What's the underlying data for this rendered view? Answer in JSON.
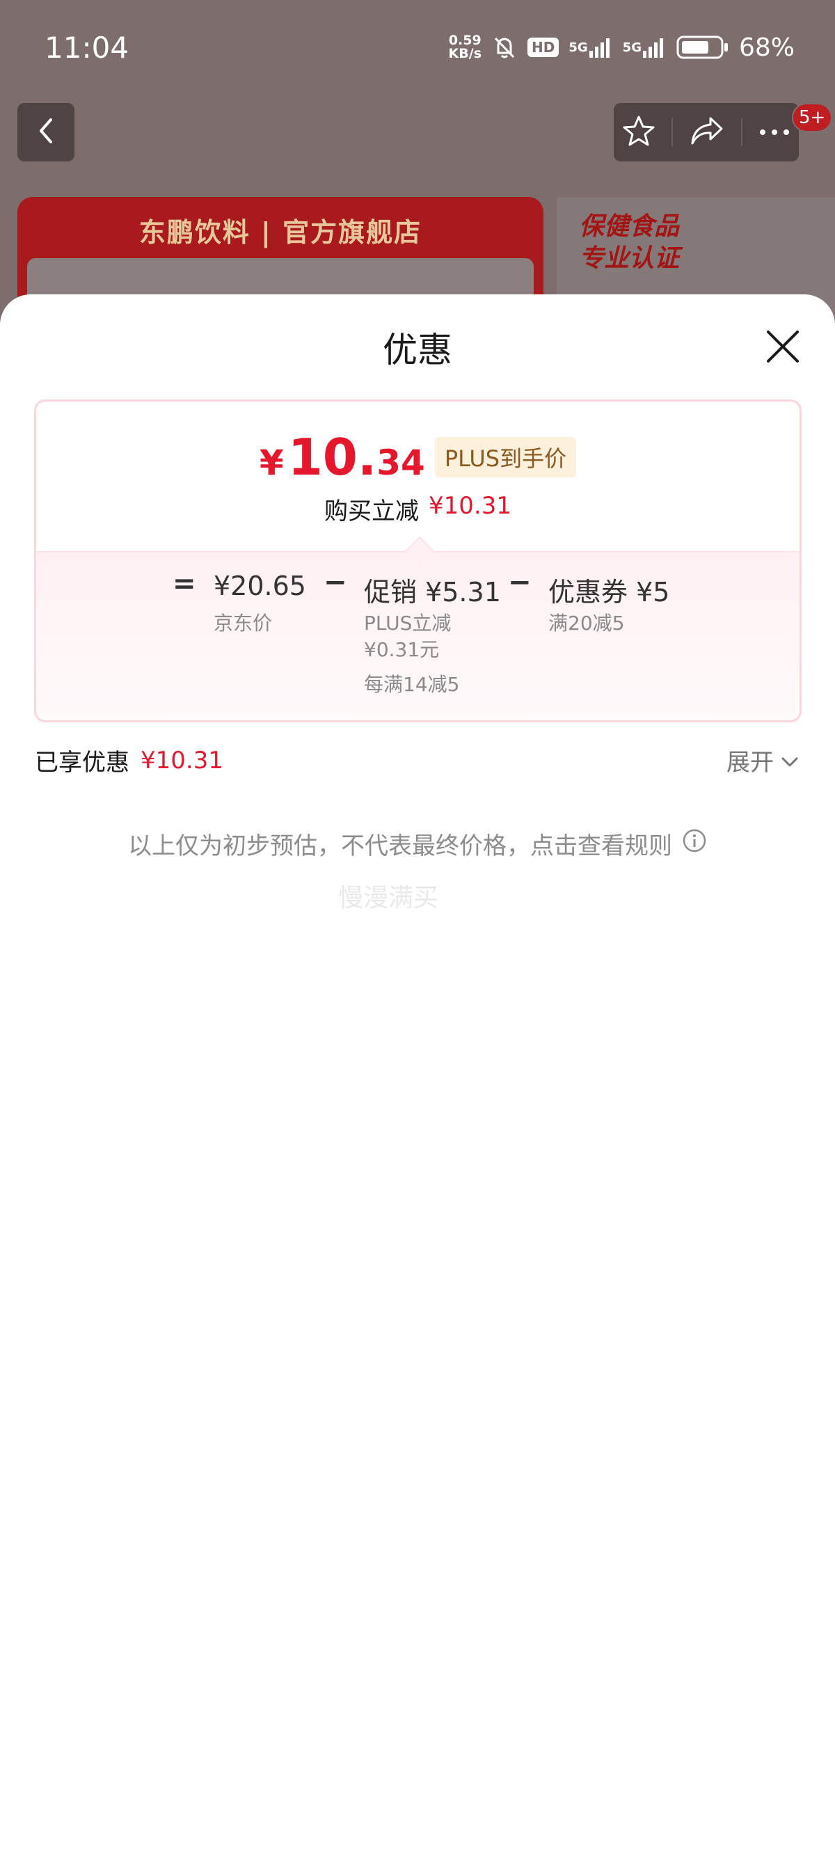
{
  "status_bar": {
    "time": "11:04",
    "net_speed_top": "0.59",
    "net_speed_bottom": "KB/s",
    "hd_badge": "HD",
    "sim1_label": "5G",
    "sim2_label": "5G",
    "battery_percent": "68%",
    "icons": [
      "mute-bell-icon",
      "signal-icon",
      "battery-icon"
    ]
  },
  "nav": {
    "back_icon": "chevron-left-icon",
    "actions": [
      "star-icon",
      "share-icon",
      "more-icon"
    ],
    "badge": "5+"
  },
  "background": {
    "store_name": "东鹏饮料 | 官方旗舰店",
    "promo_line1": "保健食品",
    "promo_line2": "专业认证"
  },
  "sheet": {
    "title": "优惠",
    "close_icon": "close-icon",
    "final_price": {
      "currency": "¥",
      "integer": "10.",
      "decimal": "34",
      "tag": "PLUS到手价"
    },
    "instant_discount": {
      "label": "购买立减",
      "value": "¥10.31"
    },
    "breakdown": {
      "equals": "=",
      "minus": "−",
      "jd_price": {
        "value": "¥20.65",
        "label": "京东价"
      },
      "promo": {
        "value": "促销 ¥5.31",
        "line1": "PLUS立减",
        "line2": "¥0.31元",
        "line3": "每满14减5"
      },
      "coupon": {
        "value": "优惠券 ¥5",
        "label": "满20减5"
      }
    },
    "enjoyed": {
      "label": "已享优惠",
      "value": "¥10.31"
    },
    "expand": {
      "label": "展开",
      "icon": "chevron-down-icon"
    },
    "disclaimer": {
      "text": "以上仅为初步预估，不代表最终价格，点击查看规则",
      "icon": "info-icon"
    },
    "ghost_text": "慢漫满买"
  },
  "colors": {
    "accent_red": "#e4172d",
    "plus_gold": "#8c5a1e",
    "card_border": "#fbd7dc"
  }
}
